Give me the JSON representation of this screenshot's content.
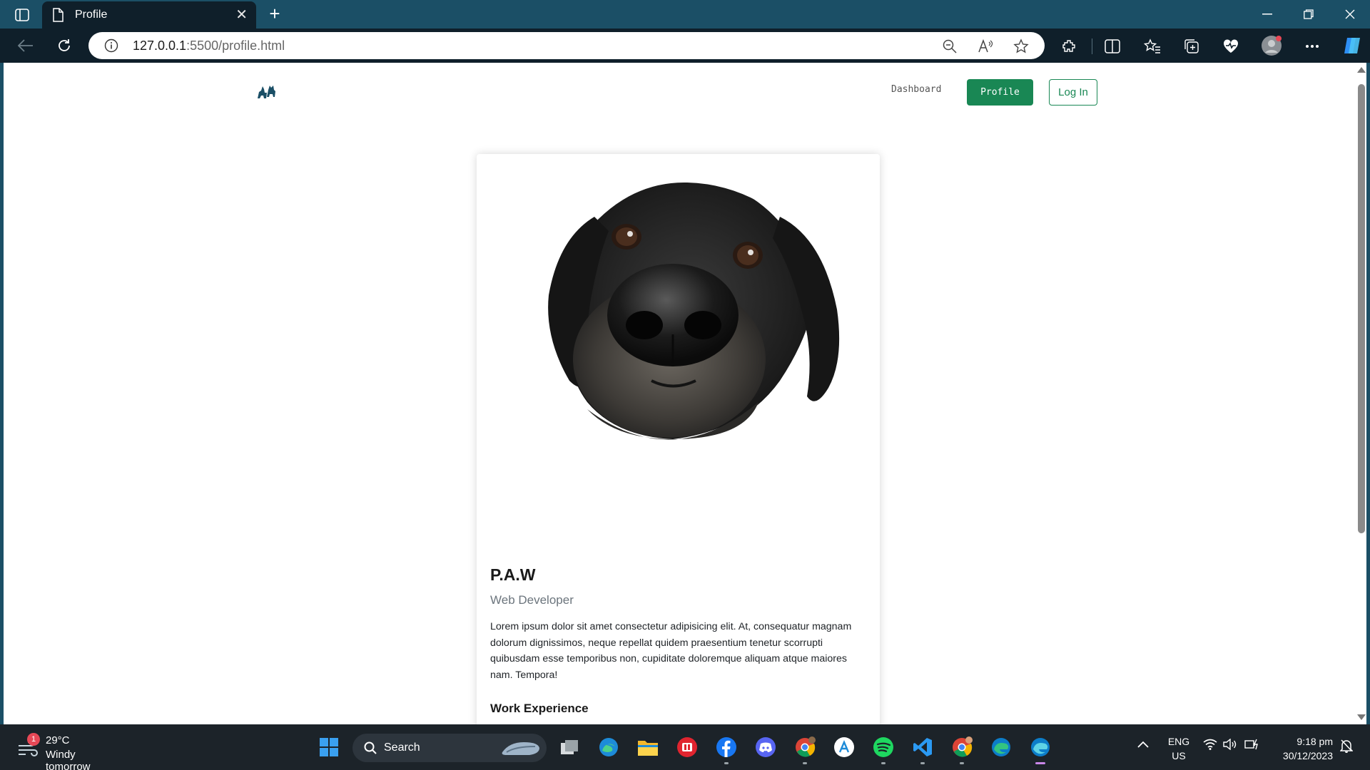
{
  "browser": {
    "tab_title": "Profile",
    "url_host": "127.0.0.1",
    "url_path": ":5500/profile.html",
    "tab_close_glyph": "✕",
    "new_tab_glyph": "+"
  },
  "site_nav": {
    "dashboard_label": "Dashboard",
    "profile_label": "Profile",
    "login_label": "Log In",
    "accent_color": "#198754"
  },
  "profile": {
    "name": "P.A.W",
    "role": "Web Developer",
    "bio": "Lorem ipsum dolor sit amet consectetur adipisicing elit. At, consequatur magnam dolorum dignissimos, neque repellat quidem praesentium tenetur scorrupti quibusdam esse temporibus non, cupiditate doloremque aliquam atque maiores nam. Tempora!",
    "section_title": "Work Experience"
  },
  "taskbar": {
    "weather_temp": "29°C",
    "weather_desc": "Windy tomorrow",
    "weather_badge": "1",
    "search_label": "Search",
    "lang_top": "ENG",
    "lang_bottom": "US",
    "time": "9:18 pm",
    "date": "30/12/2023"
  }
}
